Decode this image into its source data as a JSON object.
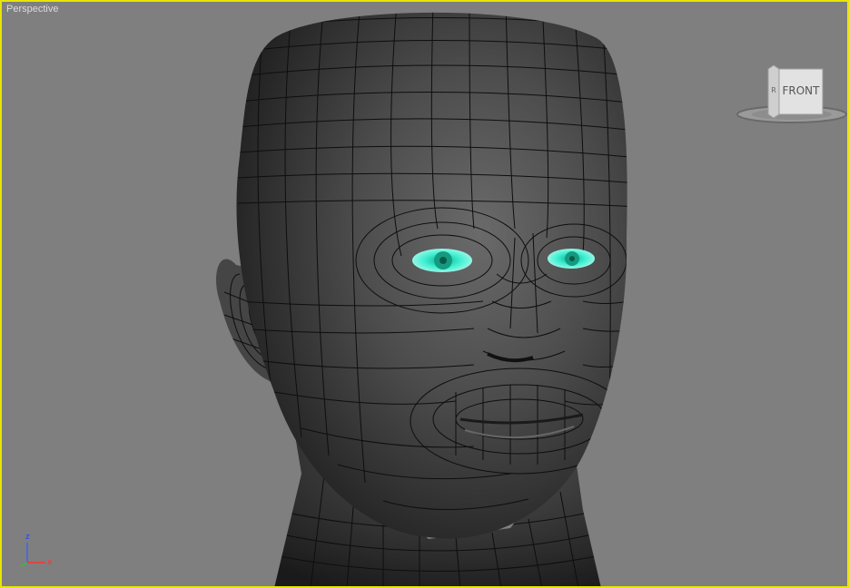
{
  "viewport": {
    "label": "Perspective",
    "background": "#7f7f7f",
    "active_border": "#e6e600"
  },
  "model": {
    "name": "head-mesh",
    "mesh_color": "#3c3c3c",
    "wire_color": "#0e0e0e",
    "selected_color": "#3ff0d2"
  },
  "viewcube": {
    "face_label": "FRONT",
    "side_label": "R"
  },
  "axis_tripod": {
    "z_label": "z",
    "x_label": "x",
    "z_color": "#4060ff",
    "x_color": "#ff3030"
  }
}
